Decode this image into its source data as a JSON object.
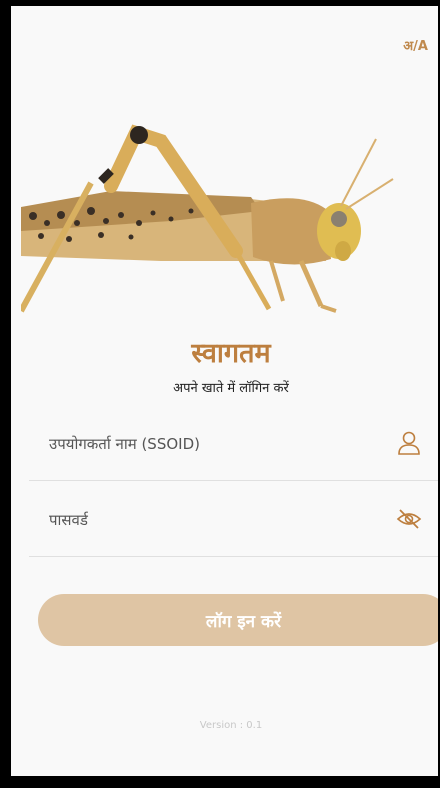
{
  "header": {
    "language_toggle": "अ/A"
  },
  "welcome": {
    "title": "स्वागतम",
    "subtitle": "अपने खाते में लॉगिन करें"
  },
  "form": {
    "username_placeholder": "उपयोगकर्ता नाम (SSOID)",
    "password_placeholder": "पासवर्ड",
    "login_label": "लॉग इन करें"
  },
  "footer": {
    "version": "Version : 0.1"
  },
  "icons": {
    "user": "user-icon",
    "password_visibility": "eye-off-icon",
    "hero": "locust-image"
  },
  "colors": {
    "accent": "#bd7f3f",
    "button": "#dfc5a4",
    "background": "#f9f9f9"
  }
}
